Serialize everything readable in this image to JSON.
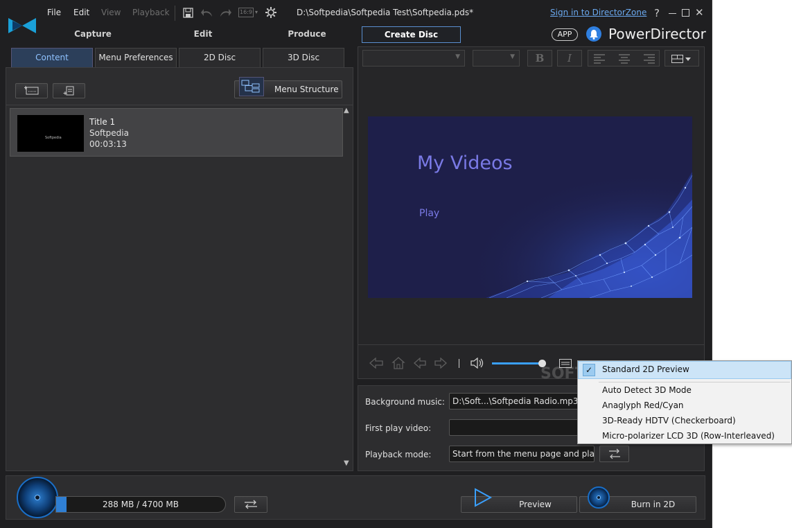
{
  "menu": {
    "file": "File",
    "edit": "Edit",
    "view": "View",
    "playback": "Playback",
    "aspect_ratio": "16:9",
    "project_path": "D:\\Softpedia\\Softpedia Test\\Softpedia.pds*",
    "sign_in": "Sign in to DirectorZone",
    "help": "?",
    "app_badge": "APP",
    "brand": "PowerDirector"
  },
  "mode_tabs": [
    {
      "label": "Capture"
    },
    {
      "label": "Edit"
    },
    {
      "label": "Produce"
    },
    {
      "label": "Create Disc"
    }
  ],
  "sub_tabs": [
    {
      "label": "Content"
    },
    {
      "label": "Menu Preferences"
    },
    {
      "label": "2D Disc"
    },
    {
      "label": "3D Disc"
    }
  ],
  "content_panel": {
    "menu_structure_label": "Menu Structure",
    "titles": [
      {
        "name": "Title 1",
        "subtitle": "Softpedia",
        "duration": "00:03:13",
        "thumb_text": "Softpedia"
      }
    ]
  },
  "preview": {
    "menu_title": "My Videos",
    "play_label": "Play"
  },
  "toolbar": {
    "bold": "B",
    "italic": "I"
  },
  "settings": {
    "bg_music_label": "Background music:",
    "bg_music_value": "D:\\Soft...\\Softpedia Radio.mp3",
    "first_play_label": "First play video:",
    "first_play_value": "",
    "playback_mode_label": "Playback mode:",
    "playback_mode_value": "Start from the menu page and play all t"
  },
  "context_menu": {
    "checked_index": 0,
    "items": [
      {
        "label": "Standard 2D Preview"
      },
      {
        "label": "Auto Detect 3D Mode"
      },
      {
        "label": "Anaglyph Red/Cyan"
      },
      {
        "label": "3D-Ready HDTV (Checkerboard)"
      },
      {
        "label": "Micro-polarizer LCD 3D (Row-Interleaved)"
      }
    ]
  },
  "bottom": {
    "capacity_text": "288 MB / 4700 MB",
    "capacity_used": 0.061,
    "preview_label": "Preview",
    "burn_label": "Burn in 2D"
  },
  "watermark": "SOFTPEDIA",
  "colors": {
    "accent": "#5a8fd0",
    "menu_bg": "#1e1f4a",
    "title_text": "#7a7ae6"
  }
}
